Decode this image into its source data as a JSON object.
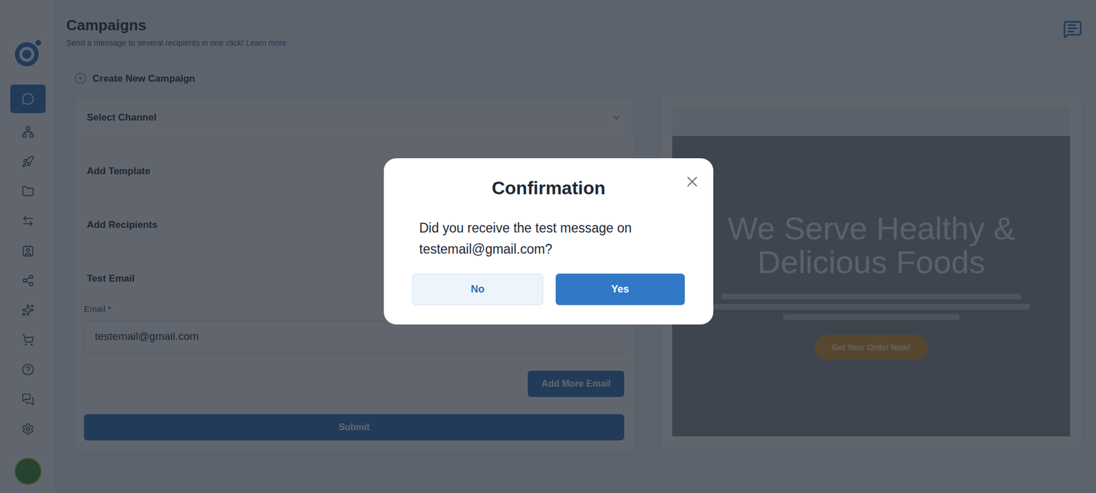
{
  "page": {
    "title": "Campaigns",
    "subtitle": "Send a message to several recipients in one click! ",
    "subtitle_link": "Learn more"
  },
  "sidebar": {
    "items": [
      {
        "selected": true
      },
      {
        "selected": false
      },
      {
        "selected": false
      },
      {
        "selected": false
      },
      {
        "selected": false
      },
      {
        "selected": false
      },
      {
        "selected": false
      },
      {
        "selected": false
      },
      {
        "selected": false
      },
      {
        "selected": false
      },
      {
        "selected": false
      },
      {
        "selected": false
      }
    ]
  },
  "form": {
    "heading": "Create New Campaign",
    "sections": [
      {
        "label": "Select Channel",
        "kind": "dropdown"
      },
      {
        "label": "Add Template",
        "kind": "plain"
      },
      {
        "label": "Add Recipients",
        "kind": "plain"
      },
      {
        "label": "Test Email",
        "kind": "plain"
      }
    ],
    "email_label": "Email *",
    "email_value": "testemail@gmail.com",
    "add_more_button": "Add More Email",
    "submit_button": "Submit"
  },
  "preview": {
    "heading": "We Serve Healthy & Delicious Foods",
    "button": "Get Your Order Now!"
  },
  "dialog": {
    "title": "Confirmation",
    "message": "Did you receive the test message on testemail@gmail.com?",
    "buttons": [
      {
        "label": "No",
        "primary": false
      },
      {
        "label": "Yes",
        "primary": true
      }
    ]
  }
}
